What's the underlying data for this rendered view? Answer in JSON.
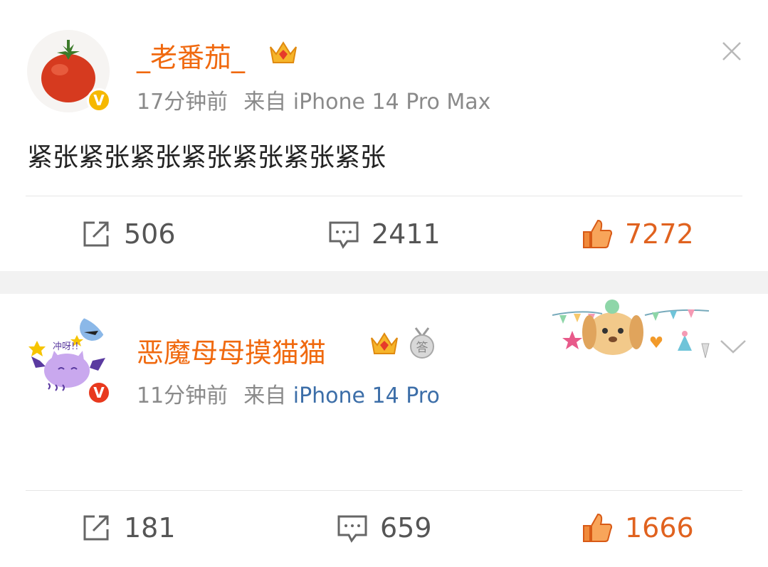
{
  "posts": [
    {
      "username": "_老番茄_",
      "time": "17分钟前",
      "source_prefix": "来自",
      "source": "iPhone 14 Pro Max",
      "verified_badge": "V",
      "content": "紧张紧张紧张紧张紧张紧张紧张",
      "reposts": "506",
      "comments": "2411",
      "likes": "7272",
      "top_right_control": "close-icon",
      "colors": {
        "username": "#f0690f",
        "badge": "#f6b800"
      }
    },
    {
      "username": "恶魔母母摸猫猫",
      "time": "11分钟前",
      "source_prefix": "来自",
      "source": "iPhone 14 Pro",
      "verified_badge": "V",
      "content": "",
      "reposts": "181",
      "comments": "659",
      "likes": "1666",
      "top_right_control": "chevron-down-icon",
      "colors": {
        "username": "#f0690f",
        "badge": "#e8391e",
        "source_link": "#3c6ea8"
      }
    }
  ],
  "avatar_texts": {
    "post2_sticker": "冲呀!!"
  },
  "medal_char": "答",
  "accent_colors": {
    "like": "#e0621f",
    "neutral_text": "#555555",
    "meta": "#8a8a8a"
  }
}
